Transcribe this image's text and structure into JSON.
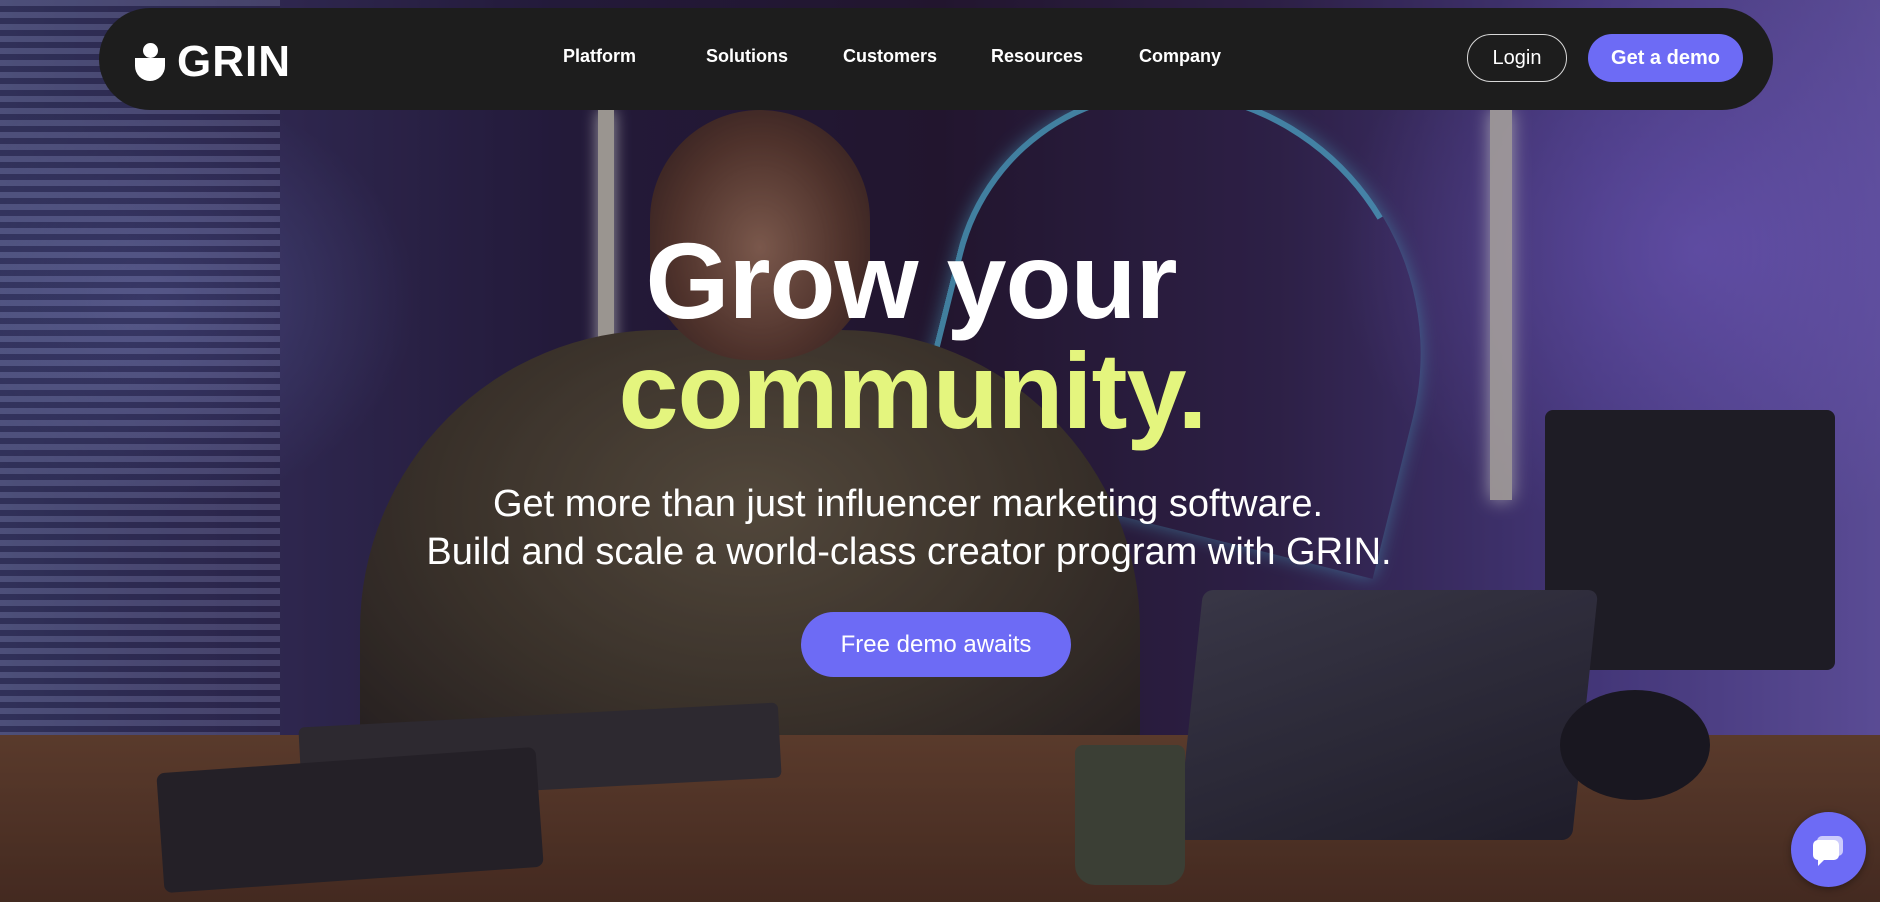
{
  "brand": {
    "name": "GRIN",
    "accent_color": "#6d6bf5",
    "highlight_color": "#e4f57e",
    "nav_bg": "#1d1d1d"
  },
  "nav": {
    "links": [
      {
        "label": "Platform"
      },
      {
        "label": "Solutions"
      },
      {
        "label": "Customers"
      },
      {
        "label": "Resources"
      },
      {
        "label": "Company"
      }
    ],
    "login_label": "Login",
    "demo_label": "Get a demo"
  },
  "hero": {
    "headline_line1": "Grow your",
    "headline_line2": "community.",
    "subheadline_line1": "Get more than just influencer marketing software.",
    "subheadline_line2": "Build and scale a world-class creator program with GRIN.",
    "cta_label": "Free demo awaits"
  },
  "chat_widget": {
    "icon": "chat-bubble-icon"
  }
}
